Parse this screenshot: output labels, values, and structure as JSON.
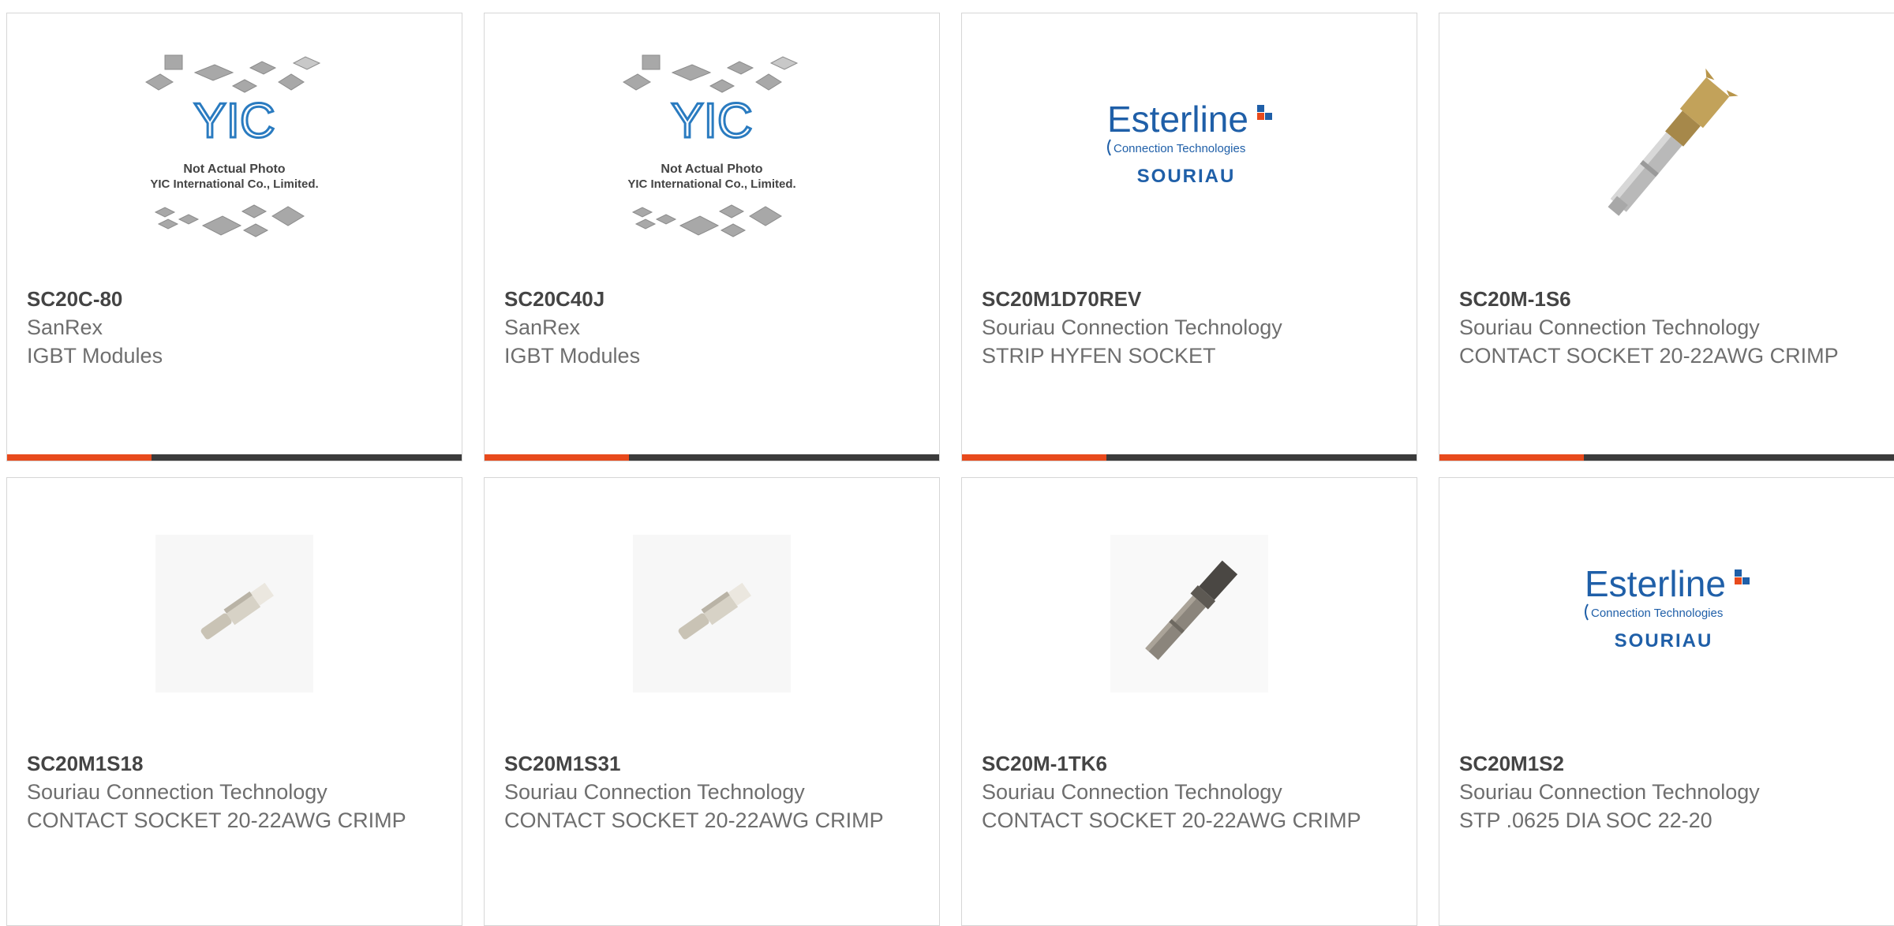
{
  "accent_color": "#e84a1c",
  "bar_color": "#3b3b3b",
  "products": [
    {
      "part_number": "SC20C-80",
      "manufacturer": "SanRex",
      "description": "IGBT Modules",
      "image": "yic-placeholder-image",
      "image_caption_1": "Not Actual Photo",
      "image_caption_2": "YIC International Co., Limited.",
      "logo_text": "YIC"
    },
    {
      "part_number": "SC20C40J",
      "manufacturer": "SanRex",
      "description": "IGBT Modules",
      "image": "yic-placeholder-image",
      "image_caption_1": "Not Actual Photo",
      "image_caption_2": "YIC International Co., Limited.",
      "logo_text": "YIC"
    },
    {
      "part_number": "SC20M1D70REV",
      "manufacturer": "Souriau Connection Technology",
      "description": "STRIP HYFEN SOCKET",
      "image": "esterline-logo",
      "logo_line_1": "Esterline",
      "logo_line_2": "Connection Technologies",
      "logo_line_3": "SOURIAU"
    },
    {
      "part_number": "SC20M-1S6",
      "manufacturer": "Souriau Connection Technology",
      "description": "CONTACT SOCKET 20-22AWG CRIMP",
      "image": "gold-contact-photo"
    },
    {
      "part_number": "SC20M1S18",
      "manufacturer": "Souriau Connection Technology",
      "description": "CONTACT SOCKET 20-22AWG CRIMP",
      "image": "silver-contact-photo"
    },
    {
      "part_number": "SC20M1S31",
      "manufacturer": "Souriau Connection Technology",
      "description": "CONTACT SOCKET 20-22AWG CRIMP",
      "image": "silver-contact-photo"
    },
    {
      "part_number": "SC20M-1TK6",
      "manufacturer": "Souriau Connection Technology",
      "description": "CONTACT SOCKET 20-22AWG CRIMP",
      "image": "dark-contact-photo"
    },
    {
      "part_number": "SC20M1S2",
      "manufacturer": "Souriau Connection Technology",
      "description": "STP .0625 DIA SOC 22-20",
      "image": "esterline-logo",
      "logo_line_1": "Esterline",
      "logo_line_2": "Connection Technologies",
      "logo_line_3": "SOURIAU"
    }
  ]
}
